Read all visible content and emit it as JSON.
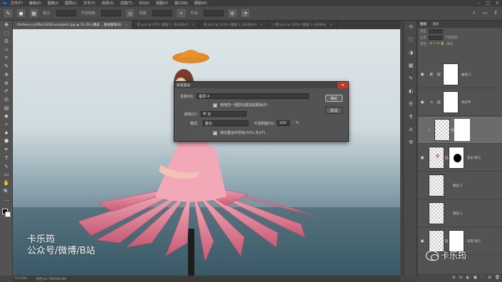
{
  "menubar": {
    "logo": "Ps",
    "items": [
      "文件(F)",
      "编辑(E)",
      "图像(I)",
      "图层(L)",
      "文字(Y)",
      "选择(S)",
      "滤镜(T)",
      "3D(D)",
      "视图(V)",
      "窗口(W)",
      "帮助(H)"
    ],
    "window_controls": [
      "–",
      "□",
      "✕"
    ]
  },
  "options": {
    "mode_label": "模式:",
    "opacity_label": "不透明度:",
    "flow_label": "流量:",
    "smooth_label": "平滑:"
  },
  "tabs": [
    {
      "label": "thirteen-j-jnPDccUVE0-unsplash.jpg @ 51.4% (橡皮... 图层蒙版/8)",
      "active": true
    },
    {
      "label": "花.psd @ 67% (图层 1, RGB/8#)",
      "active": false
    },
    {
      "label": "花.psd @ 133% (图层 2, RGB/8#)",
      "active": false
    },
    {
      "label": "人物.psd @ 100% (图层 2, RGB/8)",
      "active": false
    }
  ],
  "tools": [
    "✥",
    "⬚",
    "ʘ",
    "⊹",
    "⌗",
    "✎",
    "✜",
    "⊛",
    "✐",
    "⦿",
    "▤",
    "◆",
    "✧",
    "♠",
    "⬟",
    "✒",
    "T",
    "↖",
    "▭",
    "✋",
    "🔍",
    "…"
  ],
  "canvas": {
    "watermark_line1": "卡乐筠",
    "watermark_line2": "公众号/微博/B站"
  },
  "status": {
    "zoom": "51.43%",
    "doc": "文档:42.7M/546.8M"
  },
  "dialog": {
    "title": "新建图层",
    "close": "✕",
    "name_label": "名称(N):",
    "name_value": "图层 4",
    "clip_label": "使用前一图层创建剪贴蒙版(P)",
    "color_label": "颜色(C):",
    "color_value": "无",
    "mode_label": "模式:",
    "mode_value": "叠加",
    "opacity_label": "不透明度(O):",
    "opacity_value": "100",
    "opacity_unit": "%",
    "fill_label": "填充叠加中性色(50% 灰)(F)",
    "ok_label": "确定",
    "cancel_label": "取消"
  },
  "layers_panel": {
    "tabs": [
      "图层",
      "通道"
    ],
    "search_label": "类型",
    "mode_label": "正常",
    "opacity_label": "不透明度:",
    "lock_label": "锁定:",
    "fill_label": "填充:",
    "layers": [
      {
        "name": "曲线 3",
        "type": "adjust",
        "selected": false
      },
      {
        "name": "色彩平...",
        "type": "adjust2",
        "selected": false
      },
      {
        "name": "",
        "type": "masked",
        "selected": true
      },
      {
        "name": "花朵 拷贝",
        "type": "flower",
        "selected": false
      },
      {
        "name": "图层 2",
        "type": "empty",
        "selected": false
      },
      {
        "name": "图层 3",
        "type": "empty",
        "selected": false
      },
      {
        "name": "背景 拷贝",
        "type": "bg",
        "selected": false
      }
    ],
    "footer_icons": [
      "⊕",
      "fx",
      "◐",
      "▣",
      "🗀",
      "⊞",
      "🗑"
    ]
  },
  "wechat_watermark": "卡乐筠"
}
